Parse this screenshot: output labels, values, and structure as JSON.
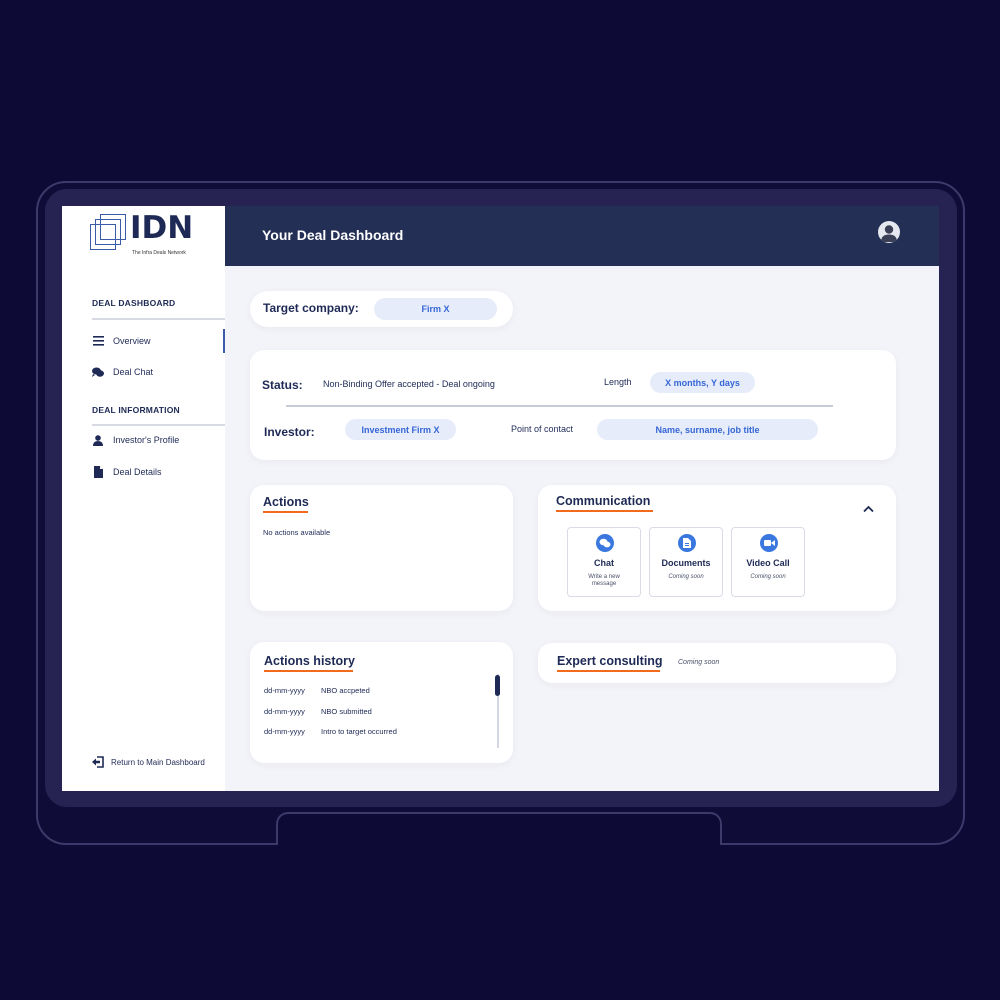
{
  "brand": {
    "logo_text": "IDN",
    "tagline": "The Infra Deals Network"
  },
  "header": {
    "title": "Your Deal Dashboard",
    "avatar_icon": "user-avatar-icon"
  },
  "sidebar": {
    "section_dashboard": "DEAL DASHBOARD",
    "section_information": "DEAL INFORMATION",
    "items": [
      {
        "label": "Overview",
        "icon": "menu-icon",
        "active": true
      },
      {
        "label": "Deal Chat",
        "icon": "chat-icon",
        "active": false
      },
      {
        "label": "Investor's Profile",
        "icon": "person-icon",
        "active": false
      },
      {
        "label": "Deal Details",
        "icon": "document-icon",
        "active": false
      }
    ],
    "return_label": "Return to Main Dashboard"
  },
  "target": {
    "label": "Target company:",
    "value": "Firm X"
  },
  "status_card": {
    "status_label": "Status:",
    "status_value": "Non-Binding Offer accepted - Deal ongoing",
    "length_label": "Length",
    "length_value": "X months, Y days",
    "investor_label": "Investor:",
    "investor_value": "Investment Firm X",
    "contact_label": "Point of contact",
    "contact_value": "Name, surname, job title"
  },
  "actions": {
    "title": "Actions",
    "empty_text": "No actions available"
  },
  "communication": {
    "title": "Communication",
    "tiles": [
      {
        "label": "Chat",
        "sub": "Write a new message",
        "icon": "chat-icon"
      },
      {
        "label": "Documents",
        "sub": "Coming soon",
        "icon": "document-icon"
      },
      {
        "label": "Video Call",
        "sub": "Coming soon",
        "icon": "video-icon"
      }
    ]
  },
  "history": {
    "title": "Actions history",
    "rows": [
      {
        "date": "dd-mm-yyyy",
        "event": "NBO accpeted"
      },
      {
        "date": "dd-mm-yyyy",
        "event": "NBO submitted"
      },
      {
        "date": "dd-mm-yyyy",
        "event": "Intro to target occurred"
      }
    ]
  },
  "expert": {
    "title": "Expert consulting",
    "status": "Coming soon"
  },
  "colors": {
    "background": "#0d0a36",
    "header": "#232f55",
    "accent_blue": "#3566d6",
    "accent_orange": "#f26a1b",
    "pill_bg": "#e7ecfa"
  }
}
